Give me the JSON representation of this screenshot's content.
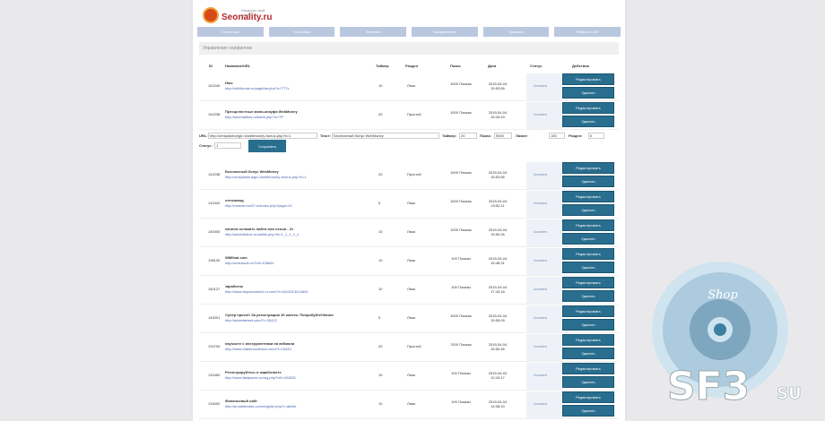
{
  "brand": {
    "name": "Seonality.ru",
    "tagline": "Раскрути свой проект"
  },
  "nav": [
    "Статистика",
    "Настройки",
    "Финансы",
    "Направления",
    "Правила",
    "Работа с UID"
  ],
  "section_title": "Управление серфингом",
  "table_headers": [
    "ID",
    "Название/URL",
    "Таймер",
    "Раздел",
    "Показ",
    "Дата",
    "Статус",
    "Действия"
  ],
  "buttons": {
    "edit": "Редактировать",
    "delete": "Удалить",
    "save": "Сохранить"
  },
  "rows_top": [
    {
      "id": "142240",
      "name": "Няш",
      "url": "http://chilihouse.ru/pagebar.php?x=TT7v",
      "timer": "10",
      "section": "Люкс",
      "shows": "1000 Показы",
      "date": "2015-04-04 15:53:56",
      "status": "Активен"
    },
    {
      "id": "142238",
      "name": "Пресцелестные мини-кнауфа WebMoney",
      "url": "http://seomatikus.ru/bank.php?n=**P",
      "timer": "20",
      "section": "Простой",
      "shows": "1000 Показы",
      "date": "2015-04-04 15:49:43",
      "status": "Активен"
    }
  ],
  "edit_form": {
    "url_label": "URL:",
    "url_value": "http://omsplaniruege.ru/webmoney-bonus.php?b=1",
    "name_label": "Текст:",
    "name_value": "Бесплатный бонус WebMoney",
    "timer_label": "Таймер:",
    "timer_value": "20",
    "shows_label": "Показ:",
    "shows_value": "5000",
    "limit_label": "Лимит:",
    "limit_value": "100",
    "section_label": "Раздел:",
    "section_value": "0",
    "status_label": "Статус:",
    "status_value": "1"
  },
  "rows": [
    {
      "id": "142238",
      "name": "Бесплатный бонус WebMoney",
      "url": "http://omsplaniruege.ru/webmoney-bonus.php?b=1",
      "timer": "20",
      "section": "Простой",
      "shows": "1000 Показы",
      "date": "2015-04-04 15:53:56",
      "status": "Активен"
    },
    {
      "id": "142442",
      "name": "оптозавод",
      "url": "http://voatorr.ree22.ru/index.php?page=10",
      "timer": "5",
      "section": "Люкс",
      "shows": "1000 Показы",
      "date": "2015-04-04 15:52:11",
      "status": "Активен"
    },
    {
      "id": "140000",
      "name": "начнем оставить найти или отзыв - 21",
      "url": "http://advertisboe.ru/adlink.php?id=1_1_1_1_1",
      "timer": "10",
      "section": "Люкс",
      "shows": "1000 Показы",
      "date": "2015-04-04 15:50:26",
      "status": "Активен"
    },
    {
      "id": "138130",
      "name": "WMfinal.com",
      "url": "http://unsubuzt.ru/?ref=108844",
      "timer": "10",
      "section": "Люкс",
      "shows": "100 Показы",
      "date": "2015-04-04 15:48:31",
      "status": "Активен"
    },
    {
      "id": "140127",
      "name": "заработок",
      "url": "http://www.bepwordmkvl.ru.com/?r=6414313414843",
      "timer": "10",
      "section": "Люкс",
      "shows": "100 Показы",
      "date": "2015-04-04 17:43:18",
      "status": "Активен"
    },
    {
      "id": "140001",
      "name": "Супер проект! За регистрацию 30 копеек. Попробуйте!Начни",
      "url": "http://advertabest.com/?r=33422",
      "timer": "5",
      "section": "Люкс",
      "shows": "1000 Показы",
      "date": "2015-04-04 15:55:09",
      "status": "Активен"
    },
    {
      "id": "134790",
      "name": "научисте с инструментами на вебмани",
      "url": "http://www.makemuvbwick.com/?r=15420",
      "timer": "20",
      "section": "Простой",
      "shows": "7000 Показы",
      "date": "2015-04-04 15:50:46",
      "status": "Активен"
    },
    {
      "id": "132450",
      "name": "Регистрируйтесь и заработаете",
      "url": "http://www.fastpaves.ru/reg.php?ref=184225",
      "timer": "10",
      "section": "Люкс",
      "shows": "100 Показы",
      "date": "2015-04-04 12:43:17",
      "status": "Активен"
    },
    {
      "id": "134000",
      "name": "Финансовый сайт",
      "url": "http://proofsbearts.com/register.php?r=abelle",
      "timer": "10",
      "section": "Люкс",
      "shows": "100 Показы",
      "date": "2015-04-04 14:08:10",
      "status": "Активен"
    }
  ],
  "watermark": {
    "shop": "Shop",
    "brand": "SF3",
    "tld": "SU"
  }
}
